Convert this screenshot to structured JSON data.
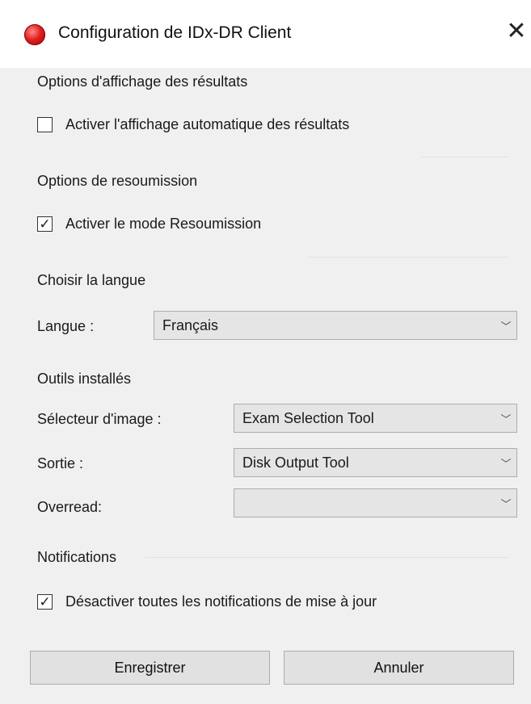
{
  "window": {
    "title": "Configuration de IDx-DR Client",
    "icon": "app-logo-icon",
    "close_glyph": "✕"
  },
  "display_options": {
    "section_title": "Options d'affichage des résultats",
    "auto_display_label": "Activer l'affichage automatique des résultats",
    "auto_display_checked": false
  },
  "resubmission": {
    "section_title": "Options de resoumission",
    "resubmit_label": "Activer le mode Resoumission",
    "resubmit_checked": true
  },
  "language": {
    "section_title": "Choisir la langue",
    "field_label": "Langue :",
    "selected": "Français"
  },
  "tools": {
    "section_title": "Outils installés",
    "image_selector_label": "Sélecteur d'image :",
    "image_selector_value": "Exam Selection Tool",
    "output_label": "Sortie :",
    "output_value": "Disk Output Tool",
    "overread_label": "Overread:",
    "overread_value": ""
  },
  "notifications": {
    "section_title": "Notifications",
    "disable_updates_label": "Désactiver toutes les notifications de mise à jour",
    "disable_updates_checked": true
  },
  "buttons": {
    "save": "Enregistrer",
    "cancel": "Annuler"
  },
  "glyphs": {
    "check": "✓",
    "chevron": "﹀"
  }
}
